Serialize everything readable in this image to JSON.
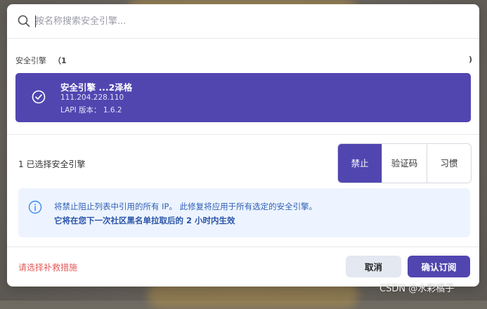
{
  "search": {
    "placeholder": "按名称搜索安全引擎..."
  },
  "group": {
    "title": "安全引擎",
    "count": "（1",
    "toggle": ")"
  },
  "engine": {
    "name": "安全引擎 ...2泽格",
    "ip": "111.204.228.110",
    "version": "LAPI 版本： 1.6.2",
    "selected": true
  },
  "selection": {
    "count_text": "1 已选择安全引擎"
  },
  "action_options": [
    {
      "label": "禁止",
      "active": true
    },
    {
      "label": "验证码",
      "active": false
    },
    {
      "label": "习惯",
      "active": false
    }
  ],
  "info": {
    "line1": "将禁止阻止列表中引用的所有 IP。 此修复将应用于所有选定的安全引擎。",
    "line2": "它将在您下一次社区黑名单拉取后的 2 小时内生效"
  },
  "footer": {
    "warning": "请选择补救措施",
    "cancel_label": "取消",
    "confirm_label": "确认订阅"
  },
  "watermark": "CSDN @水彩橘子",
  "colors": {
    "accent": "#5146b0",
    "info_bg": "#edf4ff",
    "info_text": "#2f5fb6",
    "warning": "#e45a5a",
    "cancel_bg": "#e3e8f1"
  }
}
